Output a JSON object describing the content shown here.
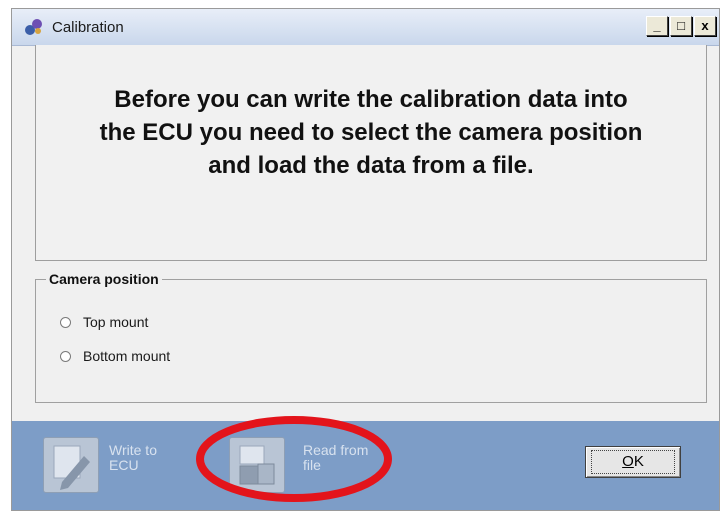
{
  "window": {
    "title": "Calibration",
    "controls": {
      "minimize": "_",
      "maximize": "□",
      "close": "x"
    }
  },
  "message": {
    "line1": "Before you can write the calibration data into",
    "line2": "the ECU you need to select the camera position",
    "line3": "and load the data from a file."
  },
  "camera_position": {
    "legend": "Camera position",
    "options": [
      {
        "label": "Top mount",
        "selected": false
      },
      {
        "label": "Bottom mount",
        "selected": false
      }
    ]
  },
  "toolbar": {
    "write_to_ecu": {
      "line1": "Write to",
      "line2": "ECU",
      "icon": "pencil-page-icon"
    },
    "read_from_file": {
      "line1": "Read from",
      "line2": "file",
      "icon": "document-folder-icon"
    },
    "ok_accel": "O",
    "ok_rest": "K"
  },
  "colors": {
    "toolbar": "#7d9dc7",
    "highlight": "#e3141b"
  }
}
